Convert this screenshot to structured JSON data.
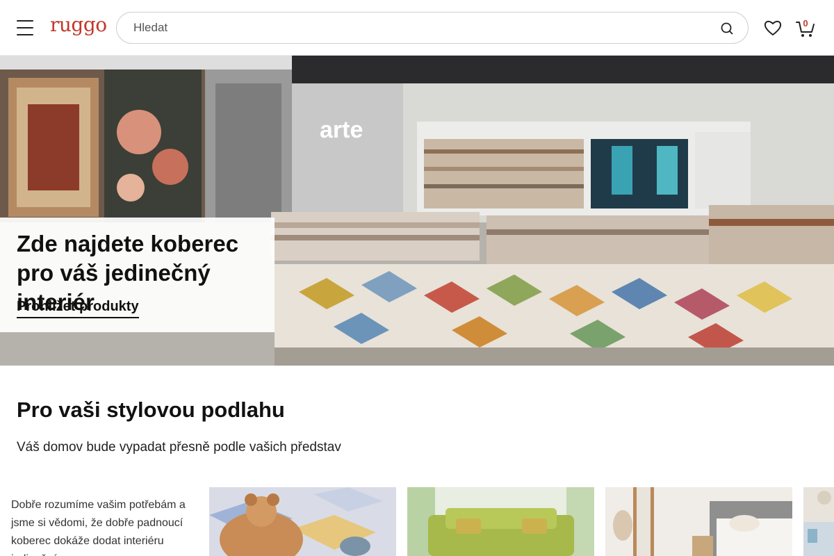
{
  "header": {
    "logo": "ruggo",
    "search_placeholder": "Hledat",
    "cart_count": "0"
  },
  "hero": {
    "title": "Zde najdete koberec pro váš jedinečný interiér",
    "link": "Prohlížet produkty",
    "store_sign": "arte"
  },
  "section": {
    "title": "Pro vaši stylovou podlahu",
    "subtitle": "Váš domov bude vypadat přesně podle vašich představ",
    "intro": "Dobře rozumíme vašim potřebám a jsme si vědomi, že dobře padnoucí koberec dokáže dodat interiéru jedinečný"
  },
  "colors": {
    "brand": "#c0392b",
    "text": "#111111"
  },
  "icons": {
    "menu": "hamburger-icon",
    "search": "search-icon",
    "wishlist": "heart-icon",
    "cart": "cart-icon"
  }
}
